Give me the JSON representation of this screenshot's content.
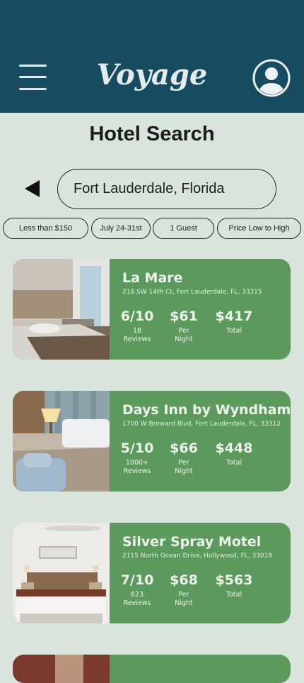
{
  "header": {
    "logo": "Voyage",
    "menu_icon": "hamburger-menu-icon",
    "profile_icon": "user-profile-icon",
    "colors": {
      "header_bg": "#164b62",
      "page_bg": "#d9e4dc",
      "card_bg": "#5b9a5c"
    }
  },
  "page_title": "Hotel Search",
  "search": {
    "value": "Fort Lauderdale, Florida",
    "back_icon": "back-triangle-icon"
  },
  "filters": [
    {
      "label": "Less than $150"
    },
    {
      "label": "July 24-31st"
    },
    {
      "label": "1 Guest"
    },
    {
      "label": "Price Low to High"
    }
  ],
  "hotels": [
    {
      "name": "La Mare",
      "address": "218 SW 14th Ct, Fort Lauderdale, FL, 33315",
      "rating": "6/10",
      "reviews": "18\nReviews",
      "price": "$61",
      "price_label": "Per\nNight",
      "total": "$417",
      "total_label": "Total"
    },
    {
      "name": "Days Inn by Wyndham",
      "address": "1700 W Broward Blvd, Fort Lauderdale, FL, 33312",
      "rating": "5/10",
      "reviews": "1000+\nReviews",
      "price": "$66",
      "price_label": "Per\nNight",
      "total": "$448",
      "total_label": "Total"
    },
    {
      "name": "Silver Spray Motel",
      "address": "2115 North Ocean Drive, Hollywood, FL, 33019",
      "rating": "7/10",
      "reviews": "623\nReviews",
      "price": "$68",
      "price_label": "Per\nNight",
      "total": "$563",
      "total_label": "Total"
    }
  ]
}
